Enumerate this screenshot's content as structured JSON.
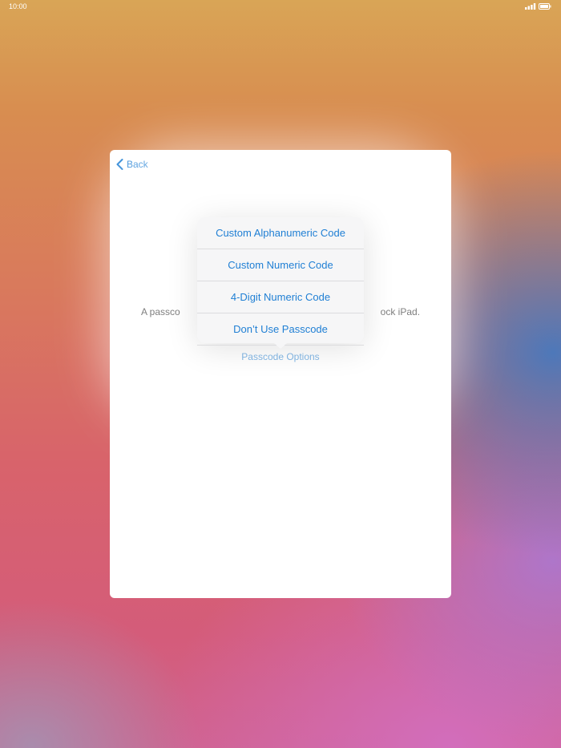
{
  "status_bar": {
    "time": "10:00",
    "signal_icon": "signal-bars-icon",
    "battery_icon": "battery-icon"
  },
  "modal": {
    "back_label": "Back",
    "back_icon": "chevron-left-icon",
    "body_text_left": "A passco",
    "body_text_right": "ock iPad.",
    "options_link": "Passcode Options"
  },
  "popover": {
    "items": [
      {
        "label": "Custom Alphanumeric Code"
      },
      {
        "label": "Custom Numeric Code"
      },
      {
        "label": "4-Digit Numeric Code"
      },
      {
        "label": "Don’t Use Passcode"
      }
    ]
  },
  "colors": {
    "accent": "#1f7fd4",
    "card": "#ffffff",
    "popover": "#f6f6f7"
  }
}
